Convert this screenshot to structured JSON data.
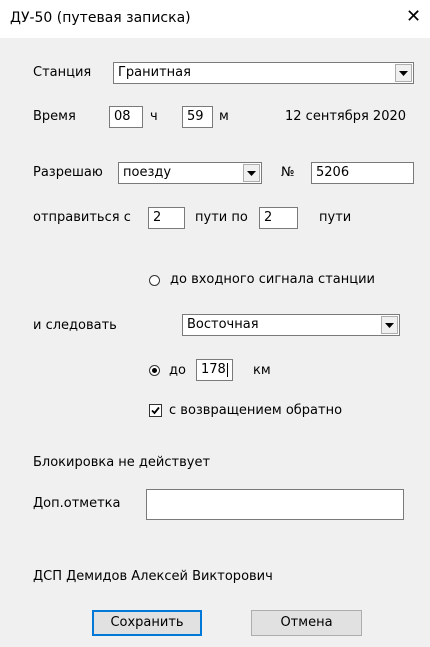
{
  "window": {
    "title": "ДУ-50 (путевая записка)",
    "close_glyph": "✕"
  },
  "station": {
    "label": "Станция",
    "value": "Гранитная"
  },
  "time": {
    "label": "Время",
    "hours": "08",
    "hours_unit": "ч",
    "minutes": "59",
    "minutes_unit": "м",
    "date": "12 сентября 2020"
  },
  "permit": {
    "label": "Разрешаю",
    "recipient": "поезду",
    "number_label": "№",
    "number": "5206"
  },
  "depart": {
    "prefix": "отправиться с",
    "from_track": "2",
    "middle": "пути по",
    "to_track": "2",
    "suffix": "пути"
  },
  "destination": {
    "signal_option": "до входного сигнала станции",
    "follow_label": "и следовать",
    "direction": "Восточная",
    "to_label": "до",
    "km_value": "178",
    "km_unit": "км",
    "return_label": "с возвращением обратно",
    "return_checked": true,
    "selected_option": "km"
  },
  "blocking": {
    "text": "Блокировка не действует"
  },
  "extra": {
    "label": "Доп.отметка",
    "value": ""
  },
  "operator": {
    "text": "ДСП Демидов Алексей Викторович"
  },
  "buttons": {
    "save": "Сохранить",
    "cancel": "Отмена"
  },
  "colors": {
    "client_bg": "#f0f0f0",
    "focus_border": "#0078d7"
  }
}
